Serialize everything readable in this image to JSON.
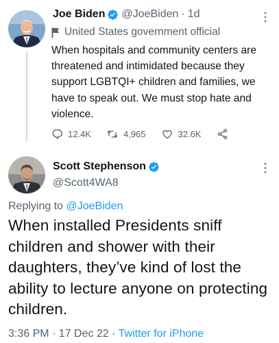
{
  "original_tweet": {
    "display_name": "Joe Biden",
    "handle": "@JoeBiden",
    "time_ago": "1d",
    "label": "United States government official",
    "text": "When hospitals and community centers are threatened and intimidated because they support LGBTQI+ children and families, we have to speak out. We must stop hate and violence.",
    "replies": "12.4K",
    "retweets": "4,965",
    "likes": "32.6K",
    "icons": [
      "verified-badge-icon",
      "flag-icon",
      "reply-icon",
      "retweet-icon",
      "like-icon",
      "share-icon",
      "more-icon"
    ]
  },
  "reply_tweet": {
    "display_name": "Scott Stephenson",
    "handle": "@Scott4WA8",
    "replying_prefix": "Replying to",
    "replying_to": "@JoeBiden",
    "text": "When installed Presidents sniff children and shower with their daughters, they’ve kind of lost the ability to lecture anyone on protecting children.",
    "timestamp": "3:36 PM · 17 Dec 22 · ",
    "source": "Twitter for iPhone"
  },
  "colors": {
    "accent": "#1d9bf0",
    "verified": "#1d9bf0",
    "secondary_text": "#536471",
    "primary_text": "#0f1419",
    "thread_line": "#cfd9de"
  }
}
